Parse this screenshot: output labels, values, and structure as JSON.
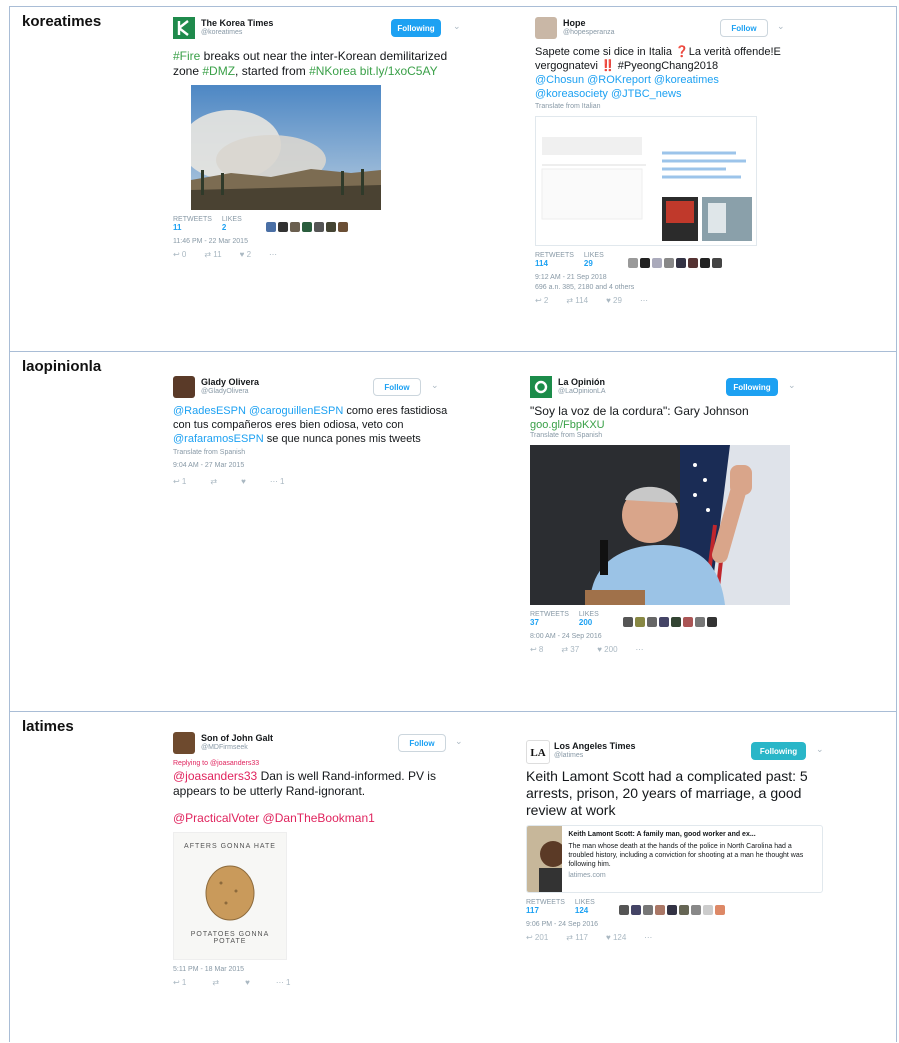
{
  "rows": [
    {
      "label": "koreatimes",
      "left": {
        "name": "The Korea Times",
        "handle": "@koreatimes",
        "button": "Following",
        "text_parts": [
          "#Fire",
          " breaks out near the inter-Korean demilitarized zone ",
          "#DMZ",
          ", started from ",
          "#NKorea",
          " bit.ly/1xoC5AY"
        ],
        "retweets_label": "RETWEETS",
        "retweets": "11",
        "likes_label": "LIKES",
        "likes": "2",
        "time": "11:46 PM - 22 Mar 2015",
        "actions": [
          "↩ 0",
          "⇄ 11",
          "♥ 2",
          "⋯"
        ]
      },
      "right": {
        "name": "Hope",
        "handle": "@hopesperanza",
        "button": "Follow",
        "text": "Sapete come si dice in Italia ❓La verità offende!E vergognatevi ‼️ #PyeongChang2018",
        "mentions": "@Chosun @ROKreport @koreatimes @koreasociety @JTBC_news",
        "translate": "Translate from Italian",
        "retweets_label": "RETWEETS",
        "retweets": "114",
        "likes_label": "LIKES",
        "likes": "29",
        "time": "9:12 AM - 21 Sep 2018",
        "others": "696 a.n. 385, 2180 and 4 others",
        "actions": [
          "↩ 2",
          "⇄ 114",
          "♥ 29",
          "⋯"
        ]
      }
    },
    {
      "label": "laopinionla",
      "left": {
        "name": "Glady Olivera",
        "handle": "@GladyOlivera",
        "button": "Follow",
        "text_parts": [
          "@RadesESPN @caroguillenESPN",
          " como eres fastidiosa con tus compañeros eres bien odiosa, veto con ",
          "@rafaramosESPN",
          " se que nunca pones mis tweets"
        ],
        "translate": "Translate from Spanish",
        "time": "9:04 AM - 27 Mar 2015",
        "actions": [
          "↩ 1",
          "⇄",
          "♥",
          "⋯ 1"
        ]
      },
      "right": {
        "name": "La Opinión",
        "handle": "@LaOpinionLA",
        "button": "Following",
        "text": "\"Soy la voz de la cordura\": Gary Johnson",
        "link": "goo.gl/FbpKXU",
        "translate": "Translate from Spanish",
        "retweets_label": "RETWEETS",
        "retweets": "37",
        "likes_label": "LIKES",
        "likes": "200",
        "time": "8:00 AM - 24 Sep 2016",
        "actions": [
          "↩ 8",
          "⇄ 37",
          "♥ 200",
          "⋯"
        ]
      }
    },
    {
      "label": "latimes",
      "left": {
        "name": "Son of John Galt",
        "handle": "@MDFirmseek",
        "button": "Follow",
        "replying": "Replying to @joasanders33",
        "text_parts": [
          "@joasanders33",
          " Dan is well Rand-informed. PV is appears to be utterly Rand-ignorant."
        ],
        "mentions": "@PracticalVoter @DanTheBookman1",
        "img_top": "AFTERS GONNA HATE",
        "img_bottom": "POTATOES GONNA POTATE",
        "time": "5:11 PM - 18 Mar 2015",
        "actions": [
          "↩ 1",
          "⇄",
          "♥",
          "⋯ 1"
        ]
      },
      "right": {
        "name": "Los Angeles Times",
        "handle": "@latimes",
        "button": "Following",
        "text": "Keith Lamont Scott had a complicated past: 5 arrests, prison, 20 years of marriage, a good review at work",
        "card_title": "Keith Lamont Scott: A family man, good worker and ex...",
        "card_desc": "The man whose death at the hands of the police in North Carolina had a troubled history, including a conviction for shooting at a man he thought was following him.",
        "card_domain": "latimes.com",
        "retweets_label": "RETWEETS",
        "retweets": "117",
        "likes_label": "LIKES",
        "likes": "124",
        "time": "9:06 PM - 24 Sep 2016",
        "actions": [
          "↩ 201",
          "⇄ 117",
          "♥ 124",
          "⋯"
        ]
      }
    }
  ],
  "colors": {
    "accent": "#1da1f2",
    "hashtag_green": "#3aa048",
    "reply_pink": "#e0245e",
    "border": "#a9bdd6"
  }
}
